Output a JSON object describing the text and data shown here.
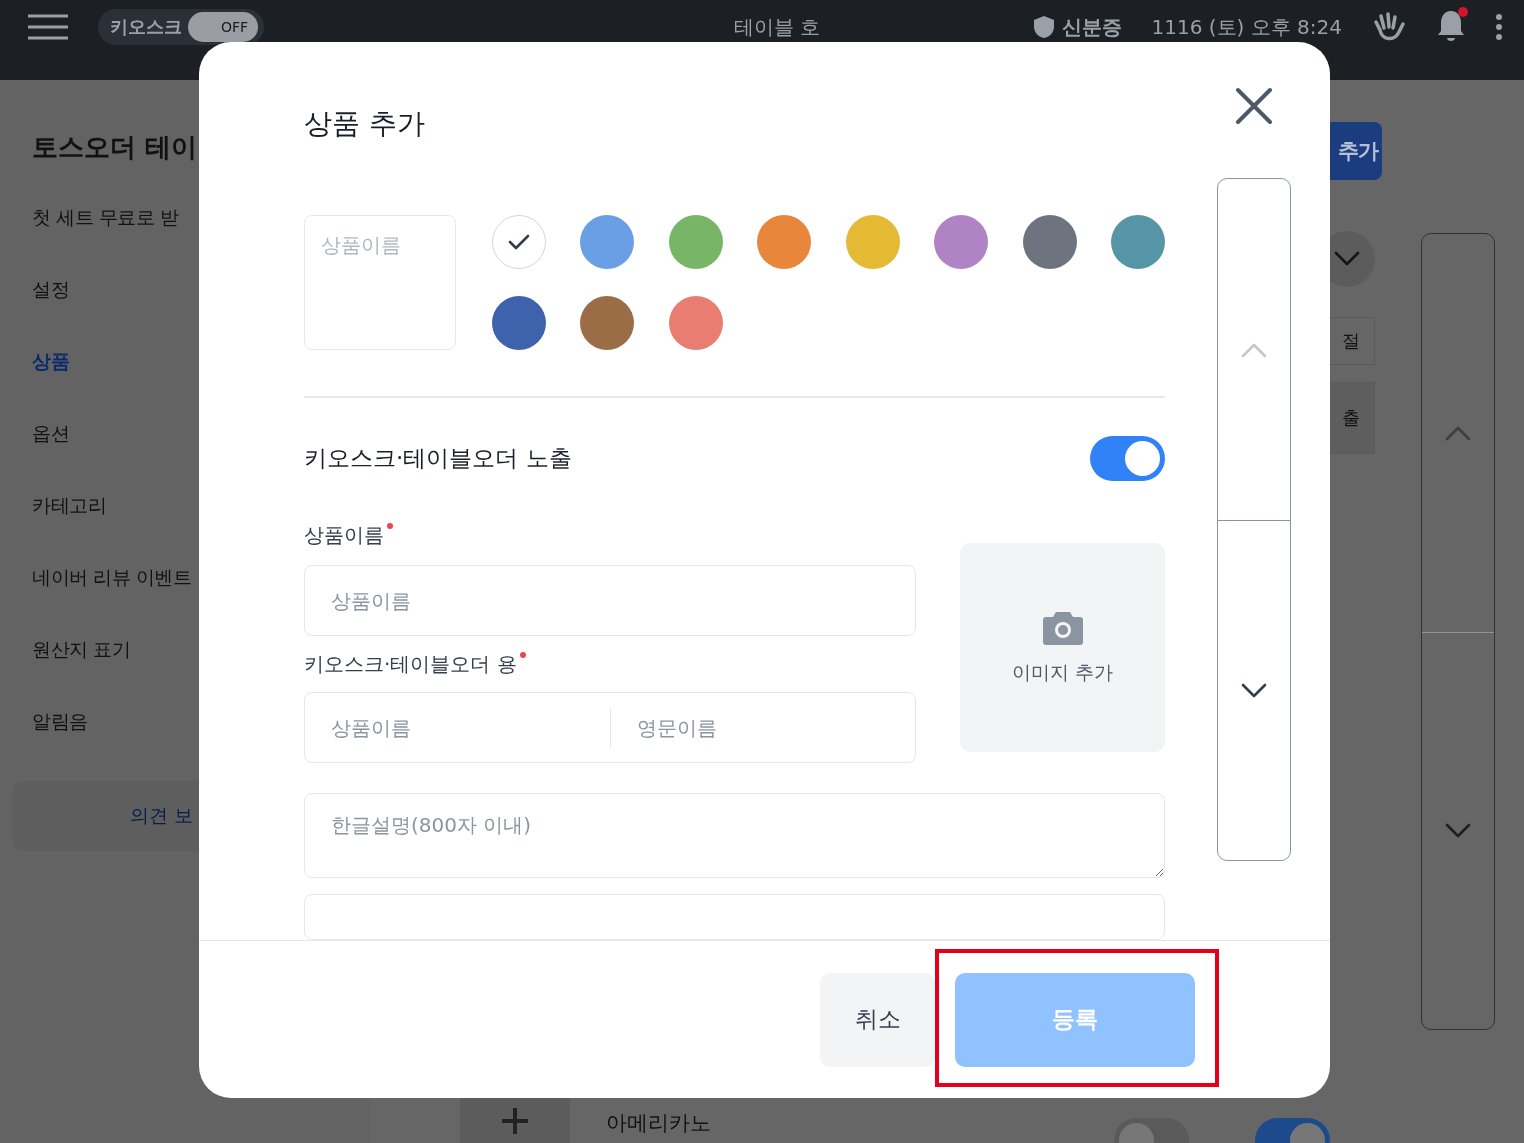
{
  "topbar": {
    "kiosk_label": "키오스크",
    "kiosk_toggle": {
      "label": "OFF",
      "on": false
    },
    "title": "테이블 호",
    "id_status": "신분증",
    "datetime": "1116 (토) 오후 8:24",
    "notification_dot": true
  },
  "sidebar": {
    "title": "토스오더 테이",
    "items": [
      {
        "label": "첫 세트 무료로 받",
        "selected": false
      },
      {
        "label": "설정",
        "selected": false
      },
      {
        "label": "상품",
        "selected": true
      },
      {
        "label": "옵션",
        "selected": false
      },
      {
        "label": "카테고리",
        "selected": false
      },
      {
        "label": "네이버 리뷰 이벤트",
        "selected": false
      },
      {
        "label": "원산지 표기",
        "selected": false
      },
      {
        "label": "알림음",
        "selected": false
      }
    ],
    "feedback_button": "의견 보"
  },
  "main": {
    "add_button": "추가",
    "chips": [
      "절",
      "출"
    ],
    "product_row": {
      "name": "아메리카노",
      "toggles": [
        {
          "on": false
        },
        {
          "on": true
        }
      ]
    }
  },
  "modal": {
    "title": "상품 추가",
    "preview_placeholder": "상품이름",
    "swatches": [
      {
        "color": "#ffffff",
        "selected": true
      },
      {
        "color": "#6a9fe6",
        "selected": false
      },
      {
        "color": "#78b566",
        "selected": false
      },
      {
        "color": "#e8873b",
        "selected": false
      },
      {
        "color": "#e4b934",
        "selected": false
      },
      {
        "color": "#b083c4",
        "selected": false
      },
      {
        "color": "#6d7480",
        "selected": false
      },
      {
        "color": "#5595a6",
        "selected": false
      },
      {
        "color": "#3e62ab",
        "selected": false
      },
      {
        "color": "#9b6d47",
        "selected": false
      },
      {
        "color": "#e97d72",
        "selected": false
      }
    ],
    "visibility": {
      "label": "키오스크·테이블오더 노출",
      "on": true
    },
    "name_field": {
      "label": "상품이름",
      "required": true,
      "placeholder": "상품이름"
    },
    "display_field": {
      "label": "키오스크·테이블오더 용",
      "required": true,
      "placeholders": [
        "상품이름",
        "영문이름"
      ]
    },
    "image_button": "이미지 추가",
    "description": {
      "placeholder": "한글설명(800자 이내)"
    },
    "buttons": [
      {
        "kind": "cancel",
        "label": "취소",
        "disabled": false,
        "highlighted": false
      },
      {
        "kind": "submit",
        "label": "등록",
        "disabled": true,
        "highlighted": true
      }
    ]
  }
}
